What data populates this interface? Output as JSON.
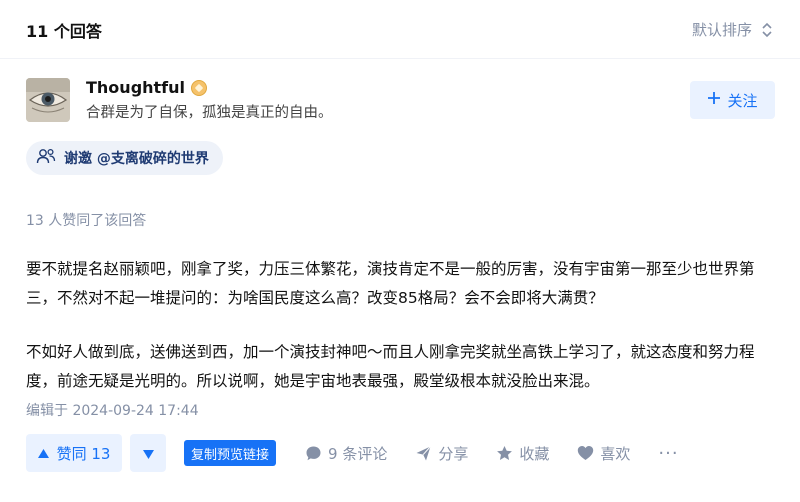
{
  "header": {
    "answer_count": "11 个回答",
    "sort_label": "默认排序"
  },
  "author": {
    "name": "Thoughtful",
    "bio": "合群是为了自保，孤独是真正的自由。",
    "follow_label": "关注"
  },
  "invite": {
    "label": "谢邀 @支离破碎的世界"
  },
  "answer": {
    "vote_summary": "13 人赞同了该回答",
    "paragraphs": [
      "要不就提名赵丽颖吧，刚拿了奖，力压三体繁花，演技肯定不是一般的厉害，没有宇宙第一那至少也世界第三，不然对不起一堆提问的：为啥国民度这么高？改变85格局？会不会即将大满贯？",
      "不如好人做到底，送佛送到西，加一个演技封神吧～而且人刚拿完奖就坐高铁上学习了，就这态度和努力程度，前途无疑是光明的。所以说啊，她是宇宙地表最强，殿堂级根本就没脸出来混。"
    ],
    "edit_time": "编辑于 2024-09-24 17:44"
  },
  "actions": {
    "vote_up_label": "赞同 13",
    "copy_link_label": "复制预览链接",
    "comment_label": "9 条评论",
    "share_label": "分享",
    "collect_label": "收藏",
    "like_label": "喜欢",
    "more_label": "···"
  },
  "colors": {
    "accent": "#1772f6",
    "accent_bg": "#eaf2ff",
    "muted": "#8590a6",
    "text": "#121212"
  }
}
